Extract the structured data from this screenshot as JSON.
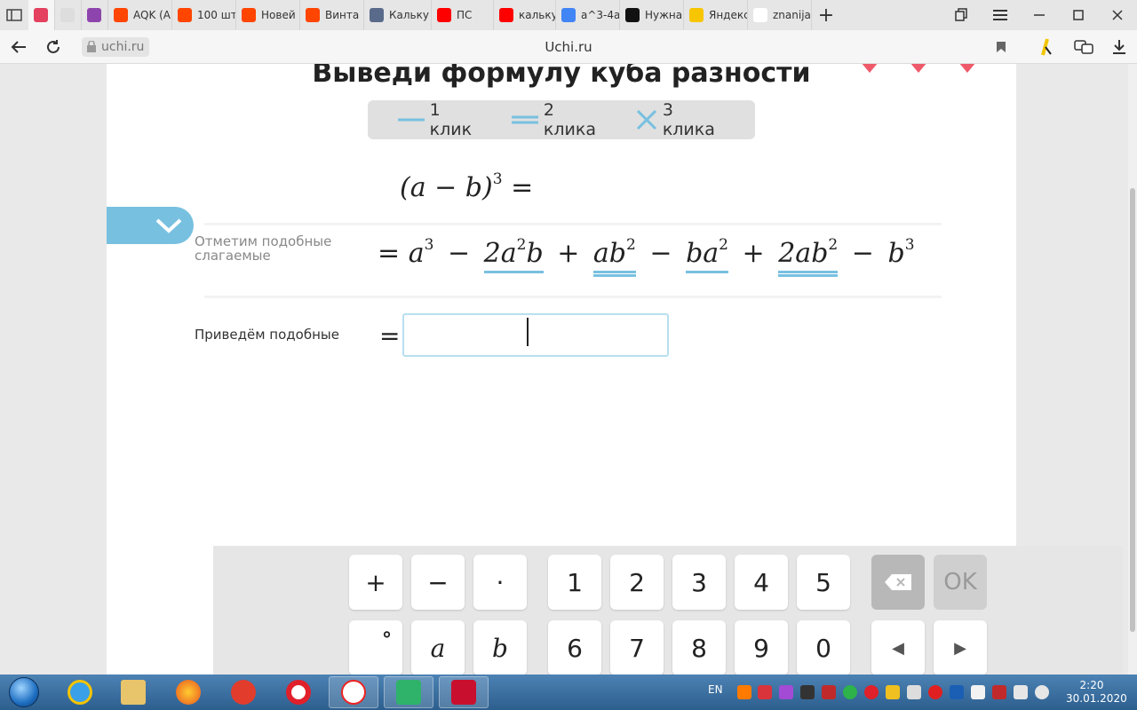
{
  "browser": {
    "tabs": [
      {
        "label": "",
        "color": "#e4405f",
        "active": true
      },
      {
        "label": "",
        "color": "#dddddd",
        "active": false
      },
      {
        "label": "",
        "color": "#8e44ad",
        "active": false
      },
      {
        "label": "AQK (A",
        "color": "#ff4500",
        "active": false
      },
      {
        "label": "100 шт",
        "color": "#ff4500",
        "active": false
      },
      {
        "label": "Новей",
        "color": "#ff4500",
        "active": false
      },
      {
        "label": "Винта",
        "color": "#ff4500",
        "active": false
      },
      {
        "label": "Кальку",
        "color": "#5a6a8a",
        "active": false
      },
      {
        "label": "ПС",
        "color": "#ff0000",
        "active": false
      },
      {
        "label": "кальку",
        "color": "#ff0000",
        "active": false
      },
      {
        "label": "a^3-4a",
        "color": "#4285f4",
        "active": false
      },
      {
        "label": "Нужна",
        "color": "#111111",
        "active": false
      },
      {
        "label": "Яндекс",
        "color": "#f7c600",
        "active": false
      },
      {
        "label": "znanija",
        "color": "#ffffff",
        "active": false
      }
    ],
    "new_tab": "+",
    "url": "uchi.ru",
    "page_title": "Uchi.ru"
  },
  "task": {
    "title": "Выведи формулу куба разности",
    "legend": [
      {
        "text": "1 клик",
        "style": "single"
      },
      {
        "text": "2 клика",
        "style": "double"
      },
      {
        "text": "3 клика",
        "style": "cross"
      }
    ],
    "expr1": {
      "lhs": "(a − b)",
      "exp": "3",
      "eq": "="
    },
    "step1": {
      "label": "Отметим подобные слагаемые",
      "eq": "=",
      "terms": [
        {
          "text": "a",
          "exp": "3",
          "op": "",
          "mark": "none"
        },
        {
          "text": "2a",
          "exp": "2",
          "tail": "b",
          "op": "−",
          "mark": "single"
        },
        {
          "text": "ab",
          "exp": "2",
          "op": "+",
          "mark": "double"
        },
        {
          "text": "ba",
          "exp": "2",
          "op": "−",
          "mark": "single"
        },
        {
          "text": "2ab",
          "exp": "2",
          "op": "+",
          "mark": "double"
        },
        {
          "text": "b",
          "exp": "3",
          "op": "−",
          "mark": "none"
        }
      ]
    },
    "step2": {
      "label": "Приведём подобные",
      "eq": "=",
      "value": ""
    }
  },
  "keyboard": {
    "row1": [
      "+",
      "−",
      "·",
      "1",
      "2",
      "3",
      "4",
      "5",
      "⌫",
      "OK"
    ],
    "row2": [
      "°",
      "a",
      "b",
      "6",
      "7",
      "8",
      "9",
      "0",
      "◀",
      "▶"
    ]
  },
  "taskbar": {
    "lang": "EN",
    "time": "2:20",
    "date": "30.01.2020"
  },
  "colors": {
    "accent": "#78c0e0",
    "heart": "#ef5a6a"
  }
}
